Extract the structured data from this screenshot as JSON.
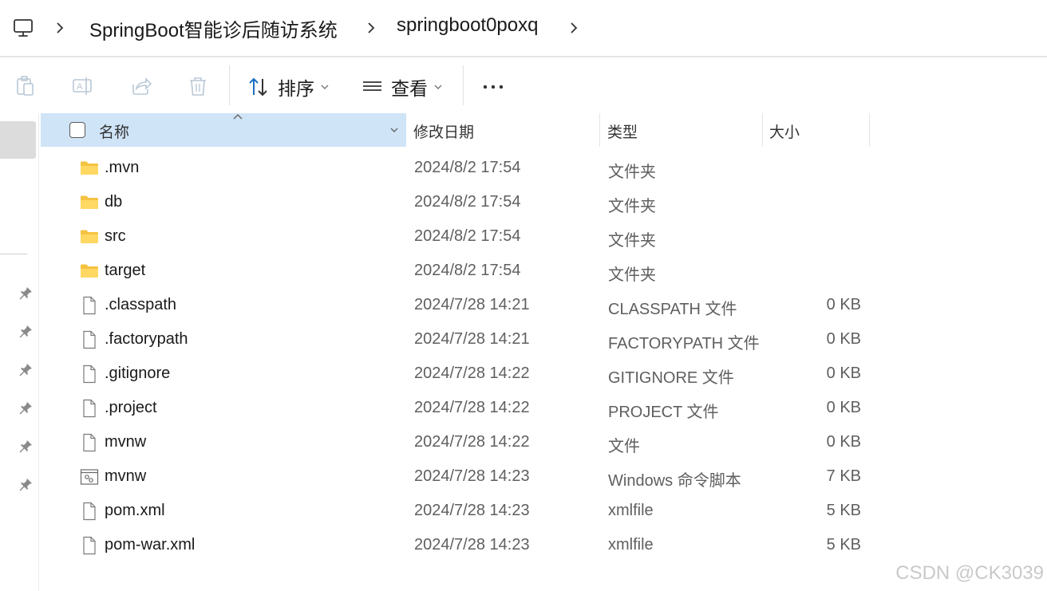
{
  "breadcrumb": {
    "items": [
      "SpringBoot智能诊后随访系统",
      "springboot0poxq"
    ]
  },
  "toolbar": {
    "sort_label": "排序",
    "view_label": "查看",
    "more_label": "···"
  },
  "columns": {
    "name": "名称",
    "date": "修改日期",
    "type": "类型",
    "size": "大小"
  },
  "files": [
    {
      "name": ".mvn",
      "date": "2024/8/2 17:54",
      "type": "文件夹",
      "size": "",
      "icon": "folder-icon"
    },
    {
      "name": "db",
      "date": "2024/8/2 17:54",
      "type": "文件夹",
      "size": "",
      "icon": "folder-icon"
    },
    {
      "name": "src",
      "date": "2024/8/2 17:54",
      "type": "文件夹",
      "size": "",
      "icon": "folder-icon"
    },
    {
      "name": "target",
      "date": "2024/8/2 17:54",
      "type": "文件夹",
      "size": "",
      "icon": "folder-icon"
    },
    {
      "name": ".classpath",
      "date": "2024/7/28 14:21",
      "type": "CLASSPATH 文件",
      "size": "0 KB",
      "icon": "file-icon"
    },
    {
      "name": ".factorypath",
      "date": "2024/7/28 14:21",
      "type": "FACTORYPATH 文件",
      "size": "0 KB",
      "icon": "file-icon"
    },
    {
      "name": ".gitignore",
      "date": "2024/7/28 14:22",
      "type": "GITIGNORE 文件",
      "size": "0 KB",
      "icon": "file-icon"
    },
    {
      "name": ".project",
      "date": "2024/7/28 14:22",
      "type": "PROJECT 文件",
      "size": "0 KB",
      "icon": "file-icon"
    },
    {
      "name": "mvnw",
      "date": "2024/7/28 14:22",
      "type": "文件",
      "size": "0 KB",
      "icon": "file-icon"
    },
    {
      "name": "mvnw",
      "date": "2024/7/28 14:23",
      "type": "Windows 命令脚本",
      "size": "7 KB",
      "icon": "script-file-icon"
    },
    {
      "name": "pom.xml",
      "date": "2024/7/28 14:23",
      "type": "xmlfile",
      "size": "5 KB",
      "icon": "file-icon"
    },
    {
      "name": "pom-war.xml",
      "date": "2024/7/28 14:23",
      "type": "xmlfile",
      "size": "5 KB",
      "icon": "file-icon"
    }
  ],
  "watermark": "CSDN @CK3039",
  "colors": {
    "header_selected": "#cfe4f6",
    "folder_yellow": "#f5c342",
    "sort_blue": "#1a6fc2"
  }
}
